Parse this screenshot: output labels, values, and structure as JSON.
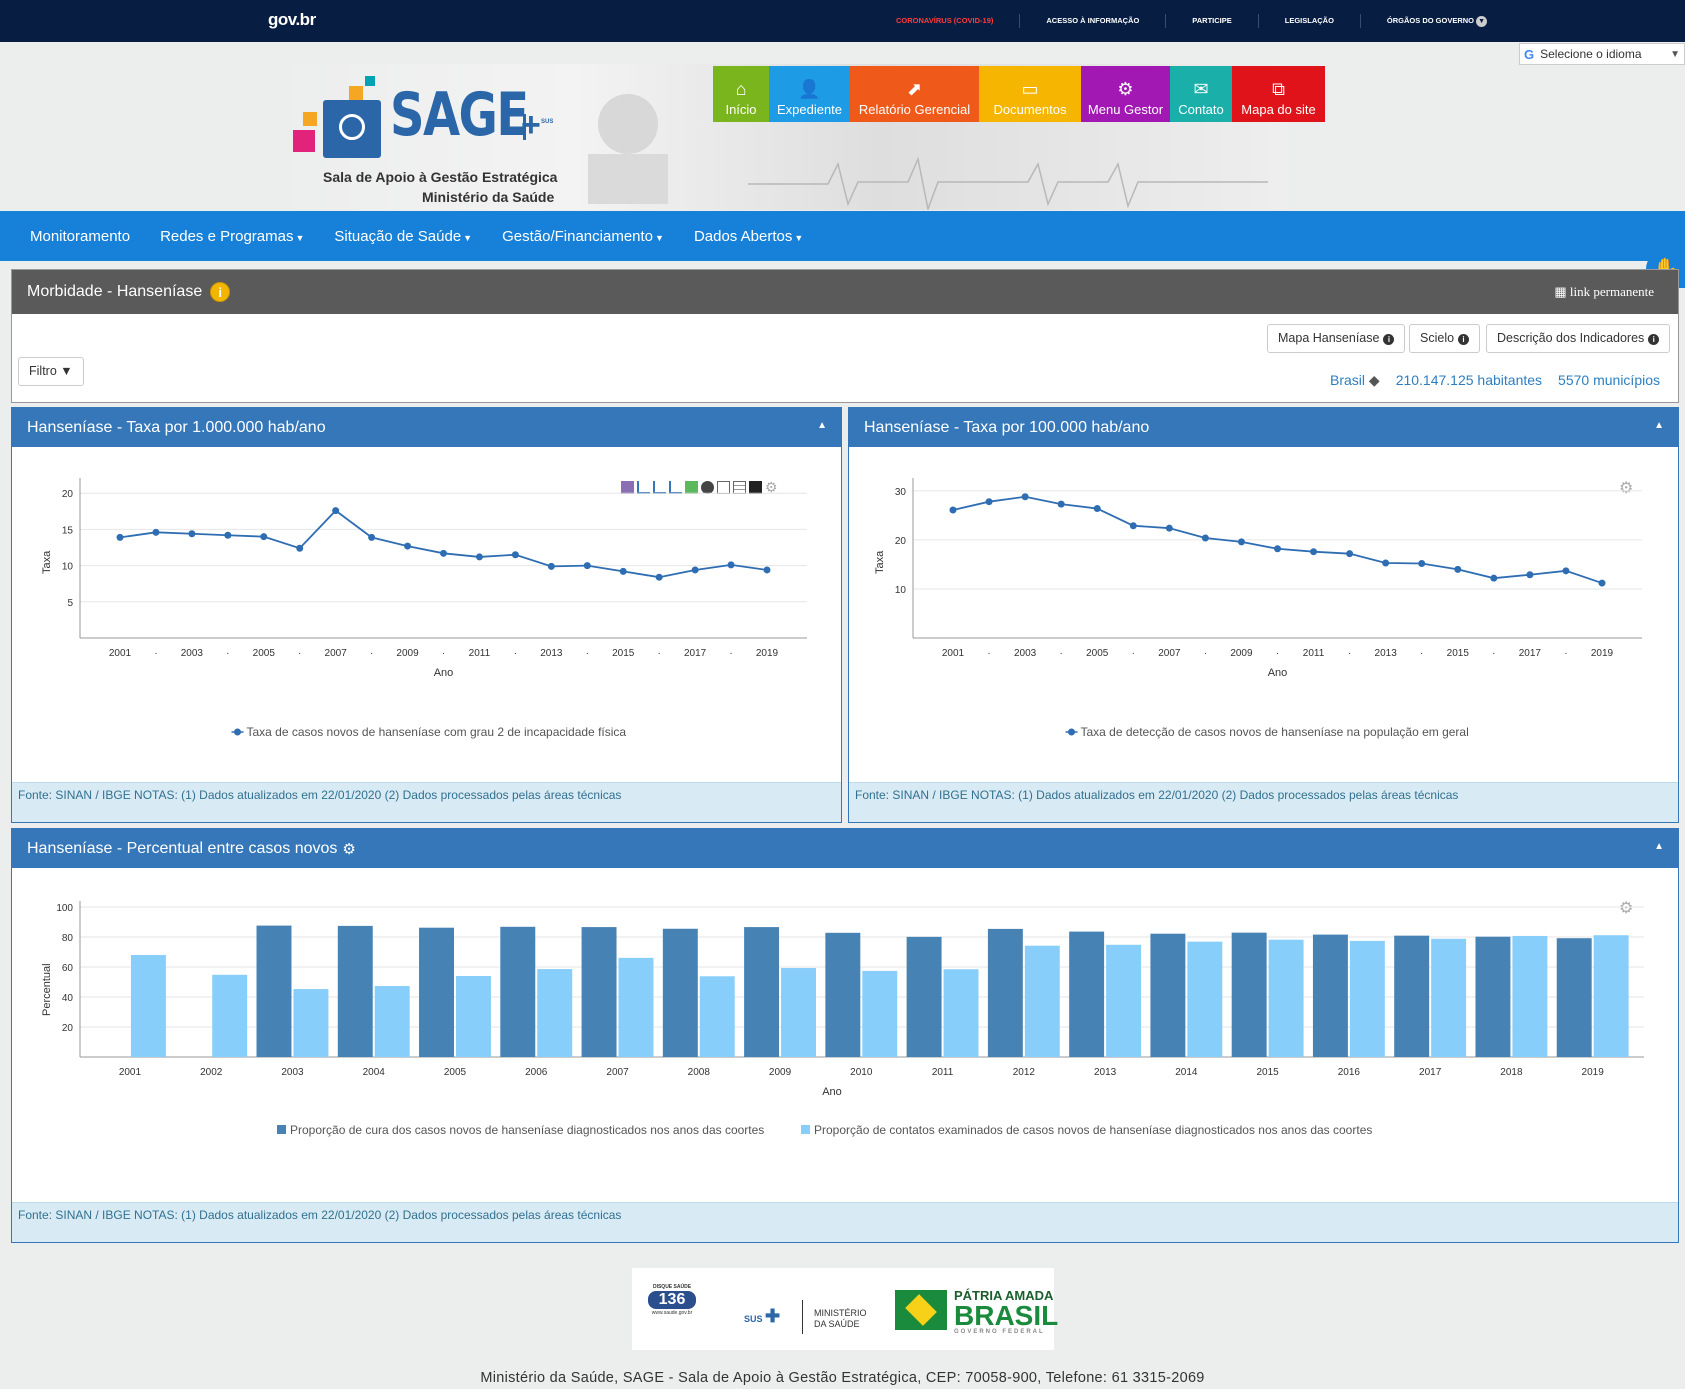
{
  "govbar": {
    "logo": "gov.br",
    "links": [
      "CORONAVÍRUS (COVID-19)",
      "ACESSO À INFORMAÇÃO",
      "PARTICIPE",
      "LEGISLAÇÃO",
      "ÓRGÃOS DO GOVERNO"
    ]
  },
  "translate": {
    "label": "Selecione o idioma"
  },
  "header": {
    "logo": "SAGE",
    "subtitle1": "Sala de Apoio à Gestão Estratégica",
    "subtitle2": "Ministério da Saúde",
    "sus_badge": "SUS",
    "tiles": [
      {
        "label": "Início",
        "color": "#7ab51d",
        "icon": "home-icon"
      },
      {
        "label": "Expediente",
        "color": "#1d9be4",
        "icon": "user-icon"
      },
      {
        "label": "Relatório Gerencial",
        "color": "#ef5a1b",
        "icon": "chart-icon"
      },
      {
        "label": "Documentos",
        "color": "#f5b500",
        "icon": "presentation-icon"
      },
      {
        "label": "Menu Gestor",
        "color": "#a119b2",
        "icon": "gears-icon"
      },
      {
        "label": "Contato",
        "color": "#1ab0a9",
        "icon": "envelope-icon"
      },
      {
        "label": "Mapa do site",
        "color": "#e0131b",
        "icon": "sitemap-icon"
      }
    ]
  },
  "nav": {
    "items": [
      "Monitoramento",
      "Redes e Programas",
      "Situação de Saúde",
      "Gestão/Financiamento",
      "Dados Abertos"
    ]
  },
  "section": {
    "title": "Morbidade - Hanseníase",
    "permalink": "link permanente",
    "filter": "Filtro",
    "buttons": [
      "Mapa Hanseníase",
      "Scielo",
      "Descrição dos Indicadores"
    ],
    "place": "Brasil",
    "population": "210.147.125 habitantes",
    "municipalities": "5570 municípios"
  },
  "footnote": "Fonte: SINAN / IBGE NOTAS: (1) Dados atualizados em 22/01/2020 (2) Dados processados pelas áreas técnicas",
  "chart_data": [
    {
      "type": "line",
      "title": "Hanseníase - Taxa por 1.000.000 hab/ano",
      "xlabel": "Ano",
      "ylabel": "Taxa",
      "x": [
        2001,
        2002,
        2003,
        2004,
        2005,
        2006,
        2007,
        2008,
        2009,
        2010,
        2011,
        2012,
        2013,
        2014,
        2015,
        2016,
        2017,
        2018,
        2019
      ],
      "x_tick_labels": [
        "2001",
        "·",
        "2003",
        "·",
        "2005",
        "·",
        "2007",
        "·",
        "2009",
        "·",
        "2011",
        "·",
        "2013",
        "·",
        "2015",
        "·",
        "2017",
        "·",
        "2019"
      ],
      "yticks": [
        5,
        10,
        15,
        20
      ],
      "ylim": [
        0,
        21
      ],
      "series": [
        {
          "name": "Taxa de casos novos de hanseníase com grau 2 de incapacidade física",
          "color": "#2f6db3",
          "values": [
            13.9,
            14.6,
            14.4,
            14.2,
            14.0,
            12.4,
            17.6,
            13.9,
            12.7,
            11.7,
            11.2,
            11.5,
            9.9,
            10.0,
            9.2,
            8.4,
            9.4,
            10.1,
            9.4
          ]
        }
      ],
      "grid": true
    },
    {
      "type": "line",
      "title": "Hanseníase - Taxa por 100.000 hab/ano",
      "xlabel": "Ano",
      "ylabel": "Taxa",
      "x": [
        2001,
        2002,
        2003,
        2004,
        2005,
        2006,
        2007,
        2008,
        2009,
        2010,
        2011,
        2012,
        2013,
        2014,
        2015,
        2016,
        2017,
        2018,
        2019
      ],
      "x_tick_labels": [
        "2001",
        "·",
        "2003",
        "·",
        "2005",
        "·",
        "2007",
        "·",
        "2009",
        "·",
        "2011",
        "·",
        "2013",
        "·",
        "2015",
        "·",
        "2017",
        "·",
        "2019"
      ],
      "yticks": [
        10,
        20,
        30
      ],
      "ylim": [
        0,
        31
      ],
      "series": [
        {
          "name": "Taxa de detecção de casos novos de hanseníase na população em geral",
          "color": "#2f6db3",
          "values": [
            26.1,
            27.8,
            28.8,
            27.3,
            26.4,
            22.9,
            22.4,
            20.4,
            19.6,
            18.2,
            17.6,
            17.2,
            15.3,
            15.2,
            14.0,
            12.2,
            12.9,
            13.7,
            11.2
          ]
        }
      ],
      "grid": true
    },
    {
      "type": "bar",
      "title": "Hanseníase - Percentual entre casos novos",
      "xlabel": "Ano",
      "ylabel": "Percentual",
      "categories": [
        "2001",
        "2002",
        "2003",
        "2004",
        "2005",
        "2006",
        "2007",
        "2008",
        "2009",
        "2010",
        "2011",
        "2012",
        "2013",
        "2014",
        "2015",
        "2016",
        "2017",
        "2018",
        "2019"
      ],
      "yticks": [
        20,
        40,
        60,
        80,
        100
      ],
      "ylim": [
        0,
        100
      ],
      "series": [
        {
          "name": "Proporção de cura dos casos novos de hanseníase diagnosticados nos anos das coortes",
          "color": "#4682b4",
          "values": [
            null,
            null,
            87.6,
            87.4,
            86.2,
            86.8,
            86.6,
            85.5,
            86.6,
            82.8,
            80.1,
            85.4,
            83.6,
            82.2,
            82.9,
            81.6,
            80.9,
            80.2,
            79.2
          ]
        },
        {
          "name": "Proporção de contatos examinados de casos novos de hanseníase diagnosticados nos anos das coortes",
          "color": "#87cefa",
          "values": [
            68.0,
            54.8,
            45.3,
            47.3,
            54.0,
            58.6,
            66.1,
            53.8,
            59.3,
            57.4,
            58.5,
            74.2,
            74.8,
            76.9,
            78.2,
            77.4,
            78.8,
            80.7,
            81.2
          ]
        }
      ],
      "grid": true
    }
  ],
  "footer": {
    "disque": "DISQUE SAÚDE",
    "disque_number": "136",
    "disque_url": "www.saude.gov.br",
    "sus": "SUS",
    "ministerio": "MINISTÉRIO DA SAÚDE",
    "patria": "PÁTRIA AMADA",
    "brasil": "BRASIL",
    "governo": "GOVERNO FEDERAL",
    "address": "Ministério da Saúde, SAGE - Sala de Apoio à Gestão Estratégica, CEP: 70058-900, Telefone: 61 3315-2069"
  }
}
